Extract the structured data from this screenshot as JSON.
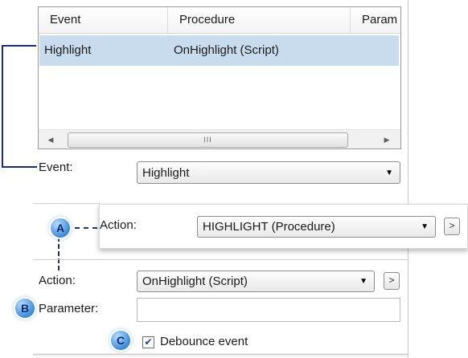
{
  "listview": {
    "columns": [
      "Event",
      "Procedure",
      "Param"
    ],
    "rows": [
      {
        "event": "Highlight",
        "procedure": "OnHighlight (Script)"
      }
    ],
    "scroll_thumb_grip": "III",
    "left_arrow": "◀",
    "right_arrow": "▶"
  },
  "event_field": {
    "label": "Event:",
    "value": "Highlight"
  },
  "callout_a": {
    "letter": "A",
    "label": "Action:",
    "value": "HIGHLIGHT (Procedure)",
    "button": ">"
  },
  "action_field": {
    "label": "Action:",
    "value": "OnHighlight (Script)",
    "button": ">"
  },
  "callout_b": {
    "letter": "B",
    "label": "Parameter:",
    "value": ""
  },
  "callout_c": {
    "letter": "C",
    "checkbox_label": "Debounce event",
    "checked": true
  },
  "icons": {
    "combo_arrow": "dropdown-arrow-icon",
    "check": "checkmark-icon"
  },
  "colors": {
    "selection": "#c9dcee",
    "connector": "#1e2d6e",
    "callout": "#3b8ad8"
  }
}
